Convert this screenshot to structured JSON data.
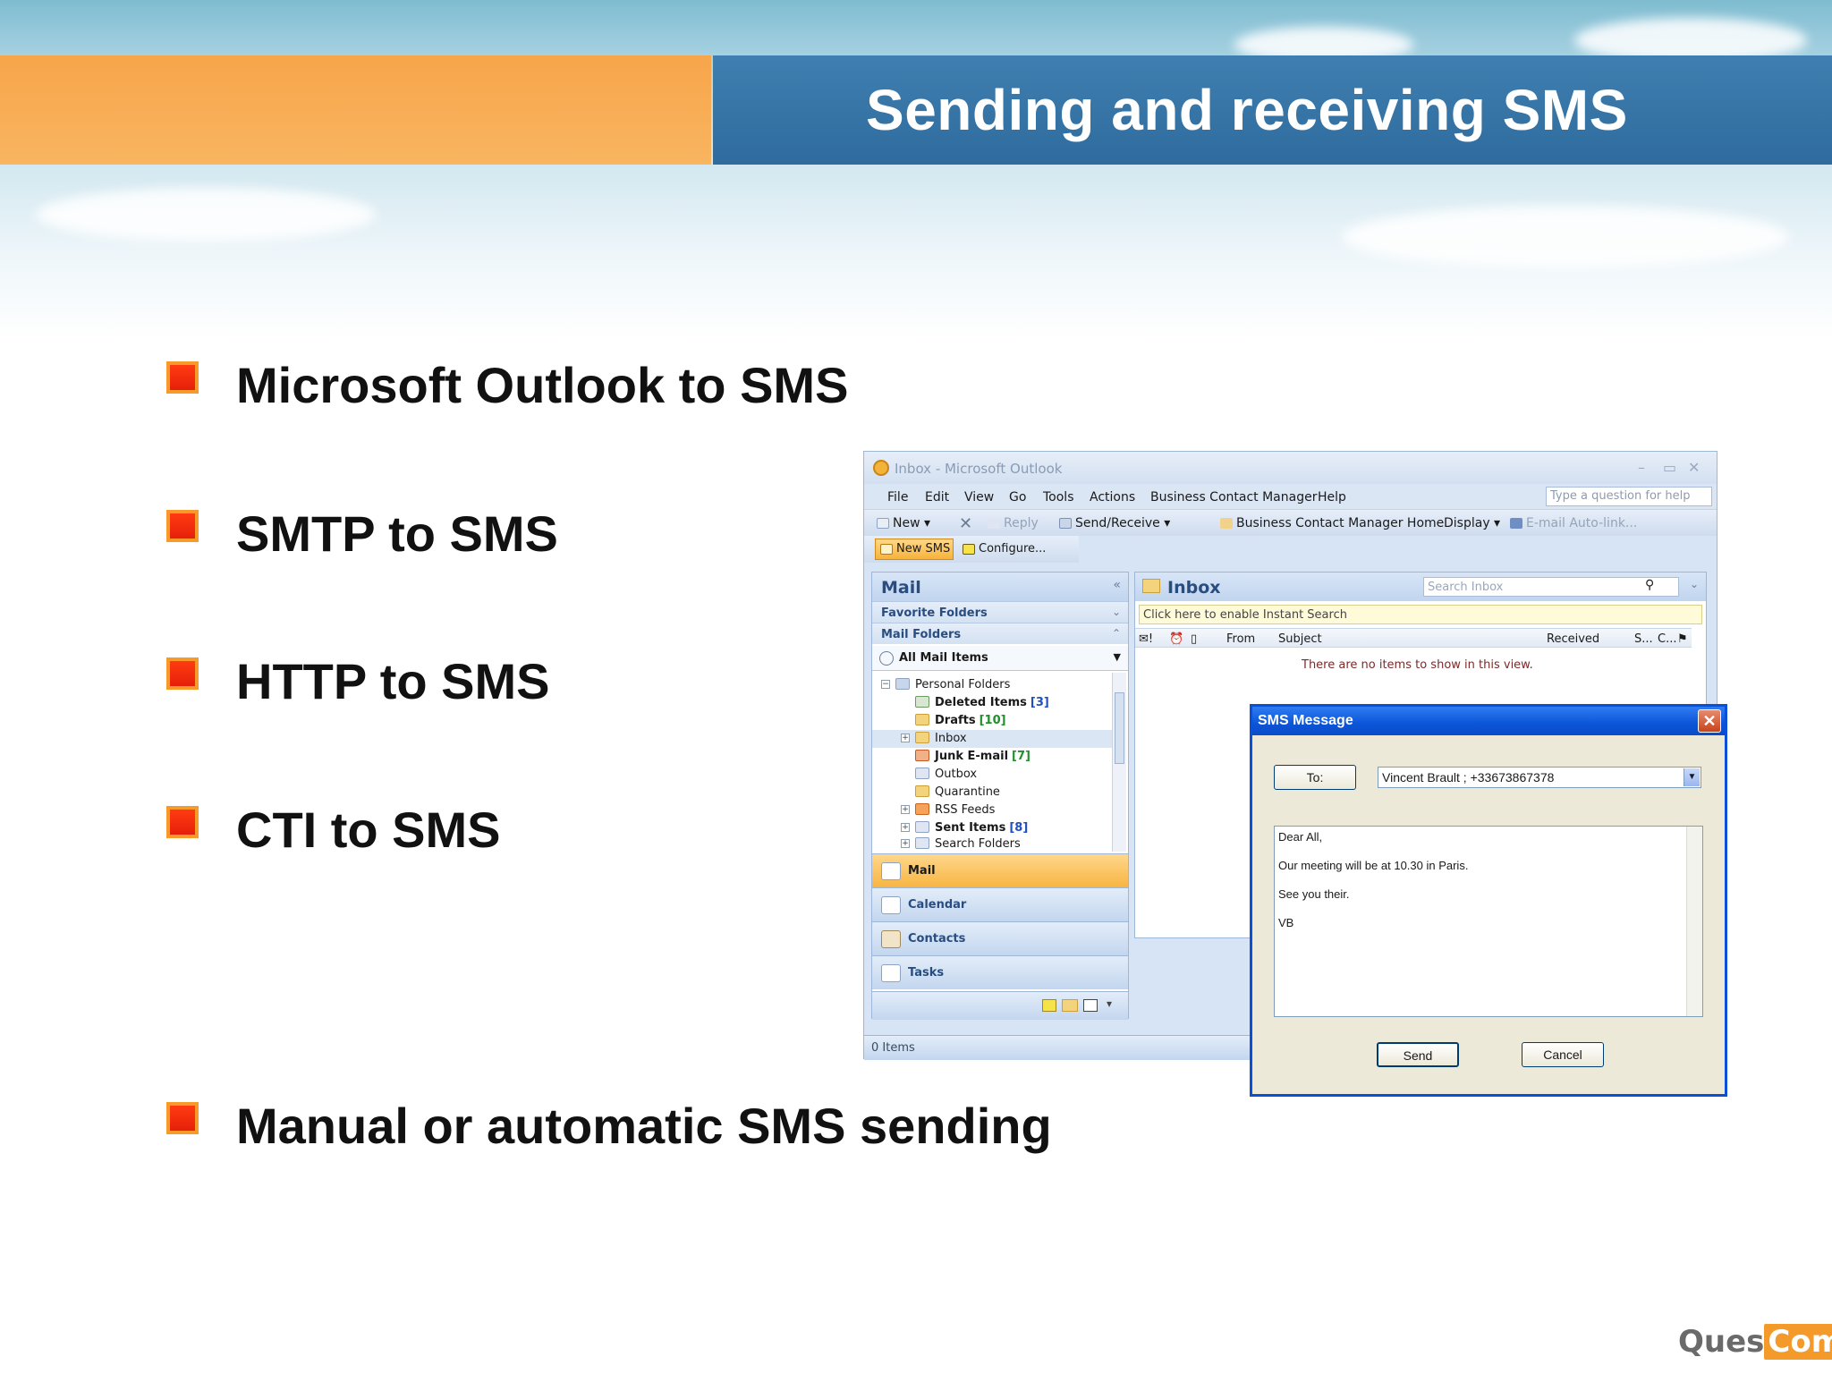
{
  "slide": {
    "title": "Sending and receiving SMS",
    "bullets": [
      "Microsoft Outlook to SMS",
      "SMTP to SMS",
      "HTTP to SMS",
      "CTI to SMS",
      "Manual or automatic SMS sending"
    ],
    "logo": {
      "part1": "Ques",
      "part2": "Com"
    }
  },
  "outlook": {
    "window_title": "Inbox - Microsoft Outlook",
    "menu": [
      "File",
      "Edit",
      "View",
      "Go",
      "Tools",
      "Actions",
      "Business Contact Manager",
      "Help"
    ],
    "help_placeholder": "Type a question for help",
    "toolbar": {
      "new": "New",
      "reply": "Reply",
      "send_receive": "Send/Receive",
      "bcm_home": "Business Contact Manager Home",
      "display": "Display",
      "email_autolink": "E-mail Auto-link..."
    },
    "sms_toolbar": {
      "new_sms": "New SMS",
      "configure": "Configure..."
    },
    "nav": {
      "header": "Mail",
      "favorite_folders": "Favorite Folders",
      "mail_folders": "Mail Folders",
      "all_mail_items": "All Mail Items",
      "root": "Personal Folders",
      "folders": [
        {
          "name": "Deleted Items",
          "count": "[3]"
        },
        {
          "name": "Drafts",
          "count": "[10]"
        },
        {
          "name": "Inbox",
          "count": ""
        },
        {
          "name": "Junk E-mail",
          "count": "[7]"
        },
        {
          "name": "Outbox",
          "count": ""
        },
        {
          "name": "Quarantine",
          "count": ""
        },
        {
          "name": "RSS Feeds",
          "count": ""
        },
        {
          "name": "Sent Items",
          "count": "[8]"
        },
        {
          "name": "Search Folders",
          "count": ""
        }
      ],
      "buttons": [
        "Mail",
        "Calendar",
        "Contacts",
        "Tasks"
      ]
    },
    "inbox": {
      "title": "Inbox",
      "search_placeholder": "Search Inbox",
      "instant_search": "Click here to enable Instant Search",
      "columns": [
        "From",
        "Subject",
        "Received",
        "S...",
        "C..."
      ],
      "empty_message": "There are no items to show in this view."
    },
    "status": "0 Items"
  },
  "sms_dialog": {
    "title": "SMS Message",
    "to_label": "To:",
    "to_value": "Vincent Brault ; +33673867378",
    "body_lines": [
      "Dear All,",
      "Our meeting will be at 10.30 in Paris.",
      "See you their.",
      "VB"
    ],
    "send": "Send",
    "cancel": "Cancel"
  }
}
